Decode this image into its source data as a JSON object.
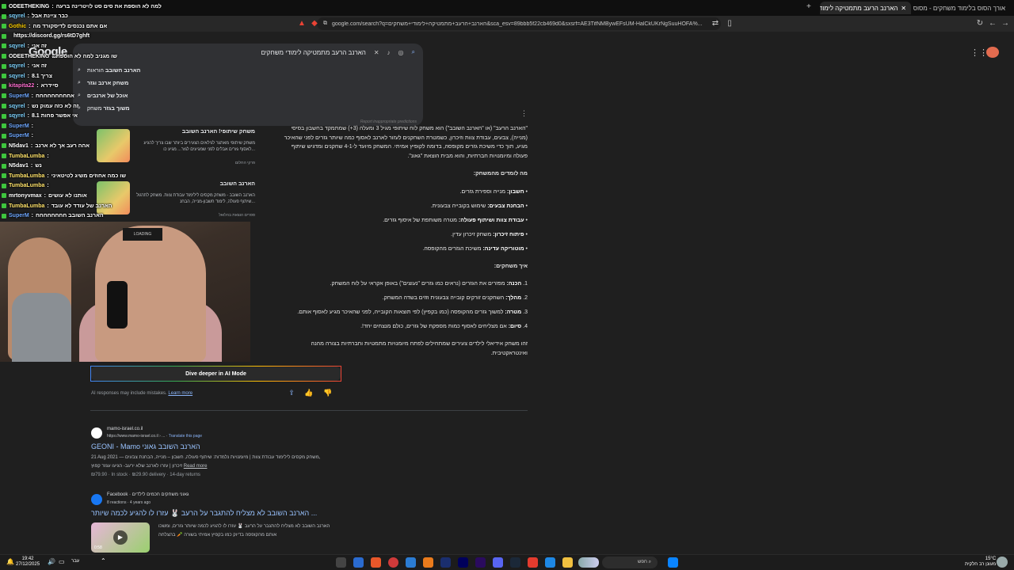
{
  "browser": {
    "tabs": [
      {
        "title": "אורך הסוס בלימוד משחקים - מסוס",
        "active": false
      },
      {
        "title": "הארנב הרעב מתמטיקה לימודי ש...",
        "active": true
      }
    ],
    "new_tab": "+",
    "url": "google.com/search?q=הארנב+הרעב+מתמטיקה+לימודי+משחקים&sca_esv=89bbb5f22cb469d0&sxsrf=AE3TifNMBywEFsUM-HalCkUKrNgSuuHOFA%..."
  },
  "search": {
    "logo": "Google",
    "query": "הארנב הרעב מתמטיקה לימודי משחקים",
    "suggestions": [
      {
        "bold": "הארנב השובב",
        "rest": " הוראות"
      },
      {
        "bold": "משחק ארנב וגזר",
        "rest": ""
      },
      {
        "bold": "אוכל של ארנבים",
        "rest": ""
      },
      {
        "bold": "משוך בגזר",
        "rest": " משחק"
      }
    ],
    "report": "Report inappropriate predictions"
  },
  "ai_overview": {
    "intro": "\"הארנב הרעב\" (או \"הארנב השובב\") הוא משחק לוח שיתופי מגיל 3 ומעלה (3+) שמתמקד בחשבון בסיסי (מנייה), צבעים, עבודת צוות וזיכרון, כשמטרת השחקנים לעזור לארנב לאסוף כמה שיותר גזרים לפני שהאיכר מגיע, תוך כדי משיכת גזרים מקופסה, בדומה לקופיץ אמיתי. המשחק מיועד ל-4-1 שחקנים ומדגיש שיתוף פעולה ומיומנויות חברתיות, והוא מבית הוצאת \"גאונ\".",
    "learn_heading": "מה לומדים מהמשחק:",
    "learn": [
      {
        "b": "חשבון:",
        "t": " מנייה וספירת גזרים."
      },
      {
        "b": "הבחנת צבעים:",
        "t": " שימוש בקובייה צבעונית."
      },
      {
        "b": "עבודת צוות ושיתוף פעולה:",
        "t": " מטרה משותפת של איסוף גזרים."
      },
      {
        "b": "פיתוח זיכרון:",
        "t": " משחק זיכרון עדין."
      },
      {
        "b": "מוטוריקה עדינה:",
        "t": " משיכת הגזרים מהקופסה."
      }
    ],
    "how_heading": "איך משחקים:",
    "how": [
      {
        "n": "1.",
        "b": "הכנה:",
        "t": " מפזרים את הגזרים (נראים כמו גזרים \"נעוצים\") באופן אקראי על לוח המשחק."
      },
      {
        "n": "2.",
        "b": "מהלך:",
        "t": " השחקנים זורקים קובייה צבעונית וזזים בשדה המשחק."
      },
      {
        "n": "3.",
        "b": "מטרה:",
        "t": " למשוך גזרים מהקופסה (כמו בקפיץ) לפי תוצאות הקובייה, לפני שהאיכר מגיע לאסוף אותם."
      },
      {
        "n": "4.",
        "b": "סיום:",
        "t": " אם מצליחים לאסוף כמות מספקת של גזרים, כולם מנצחים יחד!."
      }
    ],
    "outro": "זהו משחק אידיאלי לילדים צעירים שמתחילים לפתח מיומנויות מתמטיות וחברתיות בצורה מהנה ואינטראקטיבית.",
    "cards": [
      {
        "title": "משחק שיתופי! הארנב השובב",
        "desc": "משחק שיתופי מאתגר לגילאים הצעירים ביותר שבו צריך להגיע לאסוף גזרים אבלים לפני שמגיעים לגזר... מגיע כו...",
        "source": "פרקי החלום"
      },
      {
        "title": "הארנב השובב",
        "desc": "הארנב השובב - משחק מקסים לילימוד עבודת צוות. משחק לתרגול שיתוף פעולה, לימוד חשבון-מנייה, הבחנ...",
        "source": "ספרים הוצאת בהלואל"
      }
    ],
    "deeper": "Dive deeper in AI Mode",
    "disclaimer": "AI responses may include mistakes.",
    "learn_more": "Learn more"
  },
  "results": [
    {
      "site": "mamo-israel.co.il",
      "url": "https://www.mamo-israel.co.il › ...",
      "translate": "Translate this page",
      "title": "GEONI - Mamo הארנב השובב גאוני",
      "snippet1": "21 Aug 2021 — משחק מקסים לילימוד עבודת צוות | מיומנויות נלמדות: שיתוף פעולה, חשבון – מנייה, הבחנת צבעים,",
      "snippet2": "זיכרון | עזרו לארנב שלא ירעב- הגיעו עגזר קפוץ",
      "read_more": "Read more",
      "meta": "₪79.90 · In stock · ₪29.90 delivery · 14-day returns"
    },
    {
      "site": "Facebook",
      "sub": "גאוני משחקים חכמים לילדים",
      "reactions": "8 reactions · 4 years ago",
      "title": "הארנב השובב לא מצליח להתגבר על הרעב 🐰 עזרו לו להגיע לכמה שיותר ...",
      "snippet1": "הארנב השובב לא מצליח להתגבר על הרעב 🐰 עזרו לו להגיע לכמה שיותר גזרים, ומשכו",
      "snippet2": "אותם מהקופסה בדיוק כמו בקפיץ אמיתי בשורה 🥕 בהצלחה",
      "video_duration": "0:58"
    }
  ],
  "chat": [
    {
      "user": "ODEETHEKING",
      "msg": "למה לא הוספת את סים סט לויטרינה ברעה",
      "color": "#ffffff"
    },
    {
      "user": "sqyrel",
      "msg": "כבר ציינת אבל",
      "color": "#7fd4ff"
    },
    {
      "user": "Gothic",
      "msg": "אם אתם נכנסים לדיסקורד מה",
      "color": "#ffd000"
    },
    {
      "user": "",
      "msg": "https://discord.gg/rs6tD7ghft",
      "color": "#ffffff"
    },
    {
      "user": "sqyrel",
      "msg": "זה אני",
      "color": "#7fd4ff"
    },
    {
      "user": "ODEETHEKING",
      "msg": "שו מגניב למה לא הוספת",
      "color": "#ffffff"
    },
    {
      "user": "sqyrel",
      "msg": "זה אני",
      "color": "#7fd4ff"
    },
    {
      "user": "sqyrel",
      "msg": "8.1 צריך",
      "color": "#7fd4ff"
    },
    {
      "user": "kitapita22",
      "msg": "סיידרא",
      "color": "#ff6fd0"
    },
    {
      "user": "SuperM",
      "msg": "אחחחחחחחחח",
      "color": "#6fa8ff"
    },
    {
      "user": "sqyrel",
      "msg": "זה לא כזה עמוק נש",
      "color": "#7fd4ff"
    },
    {
      "user": "sqyrel",
      "msg": "8.1 אי אפשר פחות",
      "color": "#7fd4ff"
    },
    {
      "user": "SuperM",
      "msg": "",
      "color": "#6fa8ff"
    },
    {
      "user": "SuperM",
      "msg": "",
      "color": "#6fa8ff"
    },
    {
      "user": "N5dav1",
      "msg": "אהה רעב אך לא ארנב",
      "color": "#ffffff"
    },
    {
      "user": "TumbaLumba",
      "msg": "",
      "color": "#ffe36b"
    },
    {
      "user": "N5dav1",
      "msg": "נש",
      "color": "#ffffff"
    },
    {
      "user": "TumbaLumba",
      "msg": "שו כמה אחוזים משיג לטיטאיני",
      "color": "#ffe36b"
    },
    {
      "user": "TumbaLumba",
      "msg": "",
      "color": "#ffe36b"
    },
    {
      "user": "mrtonyvmax",
      "msg": "אותנו לא עושים",
      "color": "#ffffff"
    },
    {
      "user": "TumbaLumba",
      "msg": "הארנב של עודד לא עובד",
      "color": "#ffe36b"
    },
    {
      "user": "SuperM",
      "msg": "הארנב השובב חחחחחחחח",
      "color": "#6fa8ff"
    }
  ],
  "webcam": {
    "loading": "LOADING"
  },
  "taskbar": {
    "time": "19:42",
    "date": "27/12/2025",
    "lang": "עבר",
    "search": "חפש",
    "temp": "15°C",
    "weather": "מעונן רב חלקית"
  },
  "colors": {
    "accent": "#8ab4f8",
    "bg": "#1f1f1f",
    "chat_badge": "#3ec63e"
  }
}
